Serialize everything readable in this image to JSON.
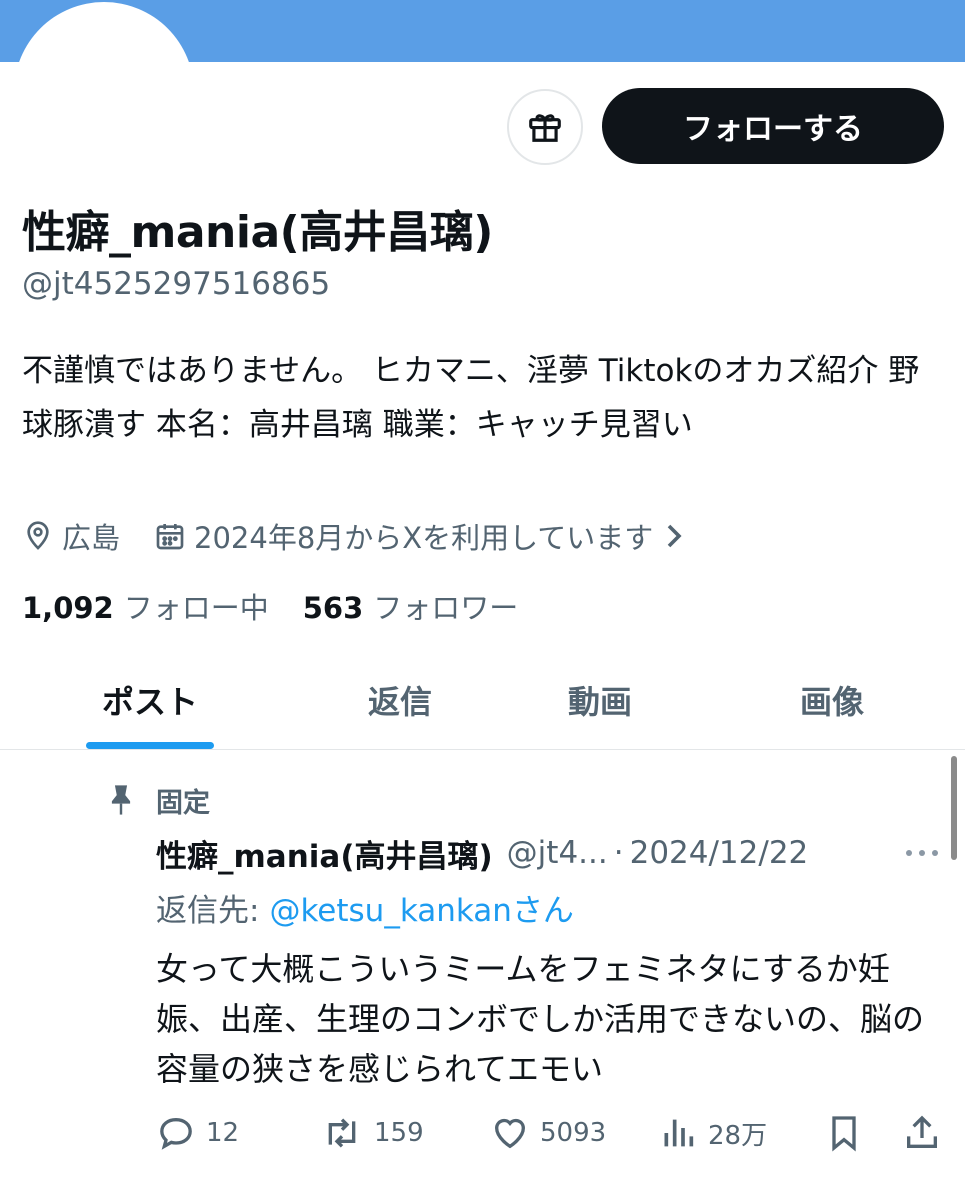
{
  "profile": {
    "name": "性癖_mania(高井昌璃)",
    "handle": "@jt4525297516865",
    "bio": "不謹慎ではありません。 ヒカマニ、淫夢 Tiktokのオカズ紹介 野球豚潰す 本名：高井昌璃 職業：キャッチ見習い",
    "location": "広島",
    "joined": "2024年8月からXを利用しています",
    "following_count": "1,092",
    "following_label": "フォロー中",
    "followers_count": "563",
    "followers_label": "フォロワー",
    "follow_button": "フォローする"
  },
  "tabs": [
    {
      "label": "ポスト",
      "active": true
    },
    {
      "label": "返信",
      "active": false
    },
    {
      "label": "動画",
      "active": false
    },
    {
      "label": "画像",
      "active": false
    }
  ],
  "post": {
    "pinned_label": "固定",
    "author_name": "性癖_mania(高井昌璃)",
    "author_handle": "@jt4...",
    "date": "2024/12/22",
    "reply_prefix": "返信先:",
    "reply_mention": "@ketsu_kankan",
    "reply_suffix": "さん",
    "text": "女って大概こういうミームをフェミネタにするか妊娠、出産、生理のコンボでしか活用できないの、脳の容量の狭さを感じられてエモい",
    "replies": "12",
    "reposts": "159",
    "likes": "5093",
    "views": "28万"
  },
  "icons": {
    "gift": "gift-icon",
    "location": "location-pin-icon",
    "calendar": "calendar-icon",
    "chevron": "chevron-right-icon",
    "pin": "pin-icon",
    "more": "more-icon",
    "reply": "reply-icon",
    "repost": "repost-icon",
    "like": "heart-icon",
    "views": "views-icon",
    "bookmark": "bookmark-icon",
    "share": "share-icon"
  },
  "colors": {
    "banner": "#5a9ee6",
    "accent": "#1d9bf0",
    "text": "#0f1419",
    "secondary": "#536471"
  }
}
